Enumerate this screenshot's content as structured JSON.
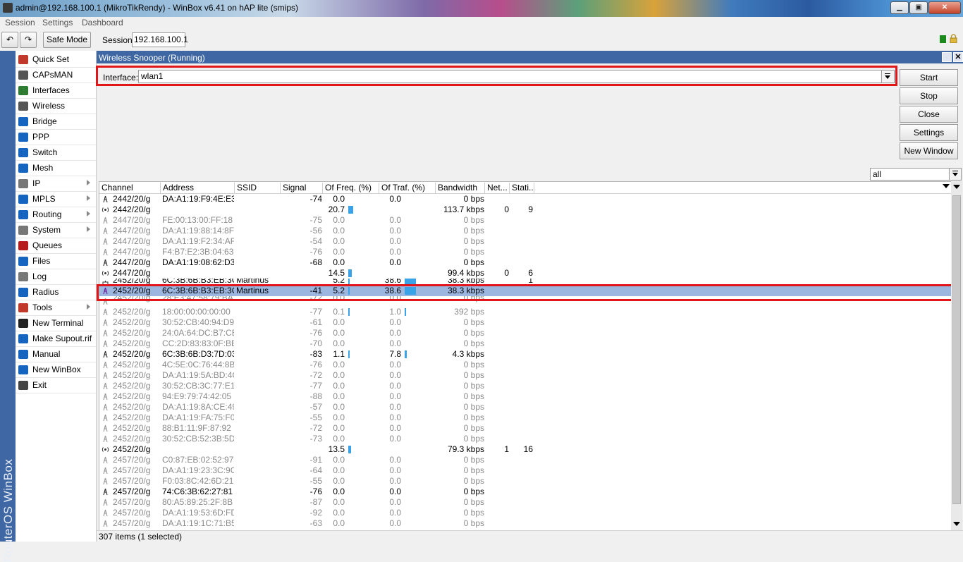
{
  "window": {
    "title": "admin@192.168.100.1 (MikroTikRendy) - WinBox v6.41 on hAP lite (smips)",
    "min_glyph": "▁",
    "max_glyph": "▣",
    "close_glyph": "✕"
  },
  "menubar": [
    "Session",
    "Settings",
    "Dashboard"
  ],
  "toolbar": {
    "undo_glyph": "↶",
    "redo_glyph": "↷",
    "safe_mode_label": "Safe Mode",
    "session_label": "Session:",
    "session_value": "192.168.100.1"
  },
  "side_strip_text": "RouterOS WinBox",
  "left_menu": [
    {
      "label": "Quick Set",
      "icon": "wand-icon",
      "color": "#c0392b",
      "submenu": false
    },
    {
      "label": "CAPsMAN",
      "icon": "antenna-icon",
      "color": "#555555",
      "submenu": false
    },
    {
      "label": "Interfaces",
      "icon": "interfaces-icon",
      "color": "#2e7d32",
      "submenu": false
    },
    {
      "label": "Wireless",
      "icon": "wireless-icon",
      "color": "#555555",
      "submenu": false
    },
    {
      "label": "Bridge",
      "icon": "bridge-icon",
      "color": "#1565c0",
      "submenu": false
    },
    {
      "label": "PPP",
      "icon": "ppp-icon",
      "color": "#1565c0",
      "submenu": false
    },
    {
      "label": "Switch",
      "icon": "switch-icon",
      "color": "#1565c0",
      "submenu": false
    },
    {
      "label": "Mesh",
      "icon": "mesh-icon",
      "color": "#1565c0",
      "submenu": false
    },
    {
      "label": "IP",
      "icon": "ip-icon",
      "color": "#777777",
      "submenu": true
    },
    {
      "label": "MPLS",
      "icon": "mpls-icon",
      "color": "#1565c0",
      "submenu": true
    },
    {
      "label": "Routing",
      "icon": "routing-icon",
      "color": "#1565c0",
      "submenu": true
    },
    {
      "label": "System",
      "icon": "system-icon",
      "color": "#777777",
      "submenu": true
    },
    {
      "label": "Queues",
      "icon": "queues-icon",
      "color": "#b71c1c",
      "submenu": false
    },
    {
      "label": "Files",
      "icon": "files-icon",
      "color": "#1565c0",
      "submenu": false
    },
    {
      "label": "Log",
      "icon": "log-icon",
      "color": "#777777",
      "submenu": false
    },
    {
      "label": "Radius",
      "icon": "radius-icon",
      "color": "#1565c0",
      "submenu": false
    },
    {
      "label": "Tools",
      "icon": "tools-icon",
      "color": "#c0392b",
      "submenu": true
    },
    {
      "label": "New Terminal",
      "icon": "terminal-icon",
      "color": "#222222",
      "submenu": false
    },
    {
      "label": "Make Supout.rif",
      "icon": "supout-icon",
      "color": "#1565c0",
      "submenu": false
    },
    {
      "label": "Manual",
      "icon": "manual-icon",
      "color": "#1565c0",
      "submenu": false
    },
    {
      "label": "New WinBox",
      "icon": "winbox-icon",
      "color": "#1565c0",
      "submenu": false
    },
    {
      "label": "Exit",
      "icon": "exit-icon",
      "color": "#444444",
      "submenu": false
    }
  ],
  "snooper": {
    "title": "Wireless Snooper (Running)",
    "close_glyph": "✕",
    "interface_label": "Interface:",
    "interface_value": "wlan1",
    "buttons": [
      "Start",
      "Stop",
      "Close",
      "Settings",
      "New Window"
    ],
    "filter_value": "all",
    "columns": [
      "Channel",
      "Address",
      "SSID",
      "Signal",
      "Of Freq. (%)",
      "Of Traf. (%)",
      "Bandwidth",
      "Net...",
      "Stati..."
    ],
    "status_text": "307 items (1 selected)",
    "bar_color": "#3aa3e8",
    "selected_color": "#9bb7e0",
    "highlight_color": "#e0161b"
  },
  "rows": [
    {
      "kind": "station",
      "dim": false,
      "channel": "2442/20/g",
      "address": "DA:A1:19:F9:4E:E3",
      "ssid": "",
      "signal": "-74",
      "freq": "0.0",
      "freq_bar": 0,
      "traf": "0.0",
      "traf_bar": 0,
      "bw": "0 bps",
      "net": "",
      "stations": ""
    },
    {
      "kind": "channel",
      "dim": false,
      "channel": "2442/20/g",
      "address": "",
      "ssid": "",
      "signal": "",
      "freq": "20.7",
      "freq_bar": 20.7,
      "traf": "",
      "traf_bar": 0,
      "bw": "113.7 kbps",
      "net": "0",
      "stations": "9"
    },
    {
      "kind": "station",
      "dim": true,
      "channel": "2447/20/g",
      "address": "FE:00:13:00:FF:18",
      "ssid": "",
      "signal": "-75",
      "freq": "0.0",
      "freq_bar": 0,
      "traf": "0.0",
      "traf_bar": 0,
      "bw": "0 bps",
      "net": "",
      "stations": ""
    },
    {
      "kind": "station",
      "dim": true,
      "channel": "2447/20/g",
      "address": "DA:A1:19:88:14:8F",
      "ssid": "",
      "signal": "-56",
      "freq": "0.0",
      "freq_bar": 0,
      "traf": "0.0",
      "traf_bar": 0,
      "bw": "0 bps",
      "net": "",
      "stations": ""
    },
    {
      "kind": "station",
      "dim": true,
      "channel": "2447/20/g",
      "address": "DA:A1:19:F2:34:AF",
      "ssid": "",
      "signal": "-54",
      "freq": "0.0",
      "freq_bar": 0,
      "traf": "0.0",
      "traf_bar": 0,
      "bw": "0 bps",
      "net": "",
      "stations": ""
    },
    {
      "kind": "station",
      "dim": true,
      "channel": "2447/20/g",
      "address": "F4:B7:E2:3B:04:63",
      "ssid": "",
      "signal": "-76",
      "freq": "0.0",
      "freq_bar": 0,
      "traf": "0.0",
      "traf_bar": 0,
      "bw": "0 bps",
      "net": "",
      "stations": ""
    },
    {
      "kind": "station",
      "dim": false,
      "channel": "2447/20/g",
      "address": "DA:A1:19:08:62:D3",
      "ssid": "",
      "signal": "-68",
      "freq": "0.0",
      "freq_bar": 0,
      "traf": "0.0",
      "traf_bar": 0,
      "bw": "0 bps",
      "net": "",
      "stations": ""
    },
    {
      "kind": "channel",
      "dim": false,
      "channel": "2447/20/g",
      "address": "",
      "ssid": "",
      "signal": "",
      "freq": "14.5",
      "freq_bar": 14.5,
      "traf": "",
      "traf_bar": 0,
      "bw": "99.4 kbps",
      "net": "0",
      "stations": "6"
    },
    {
      "kind": "network",
      "dim": false,
      "partial": true,
      "channel": "2452/20/g",
      "address": "6C:3B:6B:B3:EB:3C",
      "ssid": "Martinus",
      "signal": "",
      "freq": "5.2",
      "freq_bar": 5.2,
      "traf": "38.6",
      "traf_bar": 38.6,
      "bw": "38.3 kbps",
      "net": "",
      "stations": "1"
    },
    {
      "kind": "station",
      "dim": false,
      "selected": true,
      "channel": "2452/20/g",
      "address": "6C:3B:6B:B3:EB:3C",
      "ssid": "Martinus",
      "signal": "-41",
      "freq": "5.2",
      "freq_bar": 5.2,
      "traf": "38.6",
      "traf_bar": 38.6,
      "bw": "38.3 kbps",
      "net": "",
      "stations": ""
    },
    {
      "kind": "station",
      "dim": true,
      "partial": true,
      "channel": "2452/20/g",
      "address": "28:E3:47:58:79:BA",
      "ssid": "",
      "signal": "-72",
      "freq": "0.0",
      "freq_bar": 0,
      "traf": "0.0",
      "traf_bar": 0,
      "bw": "0 bps",
      "net": "",
      "stations": ""
    },
    {
      "kind": "station",
      "dim": true,
      "channel": "2452/20/g",
      "address": "18:00:00:00:00:00",
      "ssid": "",
      "signal": "-77",
      "freq": "0.1",
      "freq_bar": 0.1,
      "traf": "1.0",
      "traf_bar": 1.0,
      "bw": "392 bps",
      "net": "",
      "stations": ""
    },
    {
      "kind": "station",
      "dim": true,
      "channel": "2452/20/g",
      "address": "30:52:CB:40:94:D9",
      "ssid": "",
      "signal": "-61",
      "freq": "0.0",
      "freq_bar": 0,
      "traf": "0.0",
      "traf_bar": 0,
      "bw": "0 bps",
      "net": "",
      "stations": ""
    },
    {
      "kind": "station",
      "dim": true,
      "channel": "2452/20/g",
      "address": "24:0A:64:DC:B7:CB",
      "ssid": "",
      "signal": "-76",
      "freq": "0.0",
      "freq_bar": 0,
      "traf": "0.0",
      "traf_bar": 0,
      "bw": "0 bps",
      "net": "",
      "stations": ""
    },
    {
      "kind": "station",
      "dim": true,
      "channel": "2452/20/g",
      "address": "CC:2D:83:83:0F:BB",
      "ssid": "",
      "signal": "-70",
      "freq": "0.0",
      "freq_bar": 0,
      "traf": "0.0",
      "traf_bar": 0,
      "bw": "0 bps",
      "net": "",
      "stations": ""
    },
    {
      "kind": "station",
      "dim": false,
      "channel": "2452/20/g",
      "address": "6C:3B:6B:D3:7D:03",
      "ssid": "",
      "signal": "-83",
      "freq": "1.1",
      "freq_bar": 1.1,
      "traf": "7.8",
      "traf_bar": 7.8,
      "bw": "4.3 kbps",
      "net": "",
      "stations": ""
    },
    {
      "kind": "station",
      "dim": true,
      "channel": "2452/20/g",
      "address": "4C:5E:0C:76:44:8B",
      "ssid": "",
      "signal": "-76",
      "freq": "0.0",
      "freq_bar": 0,
      "traf": "0.0",
      "traf_bar": 0,
      "bw": "0 bps",
      "net": "",
      "stations": ""
    },
    {
      "kind": "station",
      "dim": true,
      "channel": "2452/20/g",
      "address": "DA:A1:19:5A:BD:4C",
      "ssid": "",
      "signal": "-72",
      "freq": "0.0",
      "freq_bar": 0,
      "traf": "0.0",
      "traf_bar": 0,
      "bw": "0 bps",
      "net": "",
      "stations": ""
    },
    {
      "kind": "station",
      "dim": true,
      "channel": "2452/20/g",
      "address": "30:52:CB:3C:77:E1",
      "ssid": "",
      "signal": "-77",
      "freq": "0.0",
      "freq_bar": 0,
      "traf": "0.0",
      "traf_bar": 0,
      "bw": "0 bps",
      "net": "",
      "stations": ""
    },
    {
      "kind": "station",
      "dim": true,
      "channel": "2452/20/g",
      "address": "94:E9:79:74:42:05",
      "ssid": "",
      "signal": "-88",
      "freq": "0.0",
      "freq_bar": 0,
      "traf": "0.0",
      "traf_bar": 0,
      "bw": "0 bps",
      "net": "",
      "stations": ""
    },
    {
      "kind": "station",
      "dim": true,
      "channel": "2452/20/g",
      "address": "DA:A1:19:8A:CE:49",
      "ssid": "",
      "signal": "-57",
      "freq": "0.0",
      "freq_bar": 0,
      "traf": "0.0",
      "traf_bar": 0,
      "bw": "0 bps",
      "net": "",
      "stations": ""
    },
    {
      "kind": "station",
      "dim": true,
      "channel": "2452/20/g",
      "address": "DA:A1:19:FA:75:F0",
      "ssid": "",
      "signal": "-55",
      "freq": "0.0",
      "freq_bar": 0,
      "traf": "0.0",
      "traf_bar": 0,
      "bw": "0 bps",
      "net": "",
      "stations": ""
    },
    {
      "kind": "station",
      "dim": true,
      "channel": "2452/20/g",
      "address": "88:B1:11:9F:87:92",
      "ssid": "",
      "signal": "-72",
      "freq": "0.0",
      "freq_bar": 0,
      "traf": "0.0",
      "traf_bar": 0,
      "bw": "0 bps",
      "net": "",
      "stations": ""
    },
    {
      "kind": "station",
      "dim": true,
      "channel": "2452/20/g",
      "address": "30:52:CB:52:3B:5D",
      "ssid": "",
      "signal": "-73",
      "freq": "0.0",
      "freq_bar": 0,
      "traf": "0.0",
      "traf_bar": 0,
      "bw": "0 bps",
      "net": "",
      "stations": ""
    },
    {
      "kind": "channel",
      "dim": false,
      "channel": "2452/20/g",
      "address": "",
      "ssid": "",
      "signal": "",
      "freq": "13.5",
      "freq_bar": 13.5,
      "traf": "",
      "traf_bar": 0,
      "bw": "79.3 kbps",
      "net": "1",
      "stations": "16"
    },
    {
      "kind": "station",
      "dim": true,
      "channel": "2457/20/g",
      "address": "C0:87:EB:02:52:97",
      "ssid": "",
      "signal": "-91",
      "freq": "0.0",
      "freq_bar": 0,
      "traf": "0.0",
      "traf_bar": 0,
      "bw": "0 bps",
      "net": "",
      "stations": ""
    },
    {
      "kind": "station",
      "dim": true,
      "channel": "2457/20/g",
      "address": "DA:A1:19:23:3C:9C",
      "ssid": "",
      "signal": "-64",
      "freq": "0.0",
      "freq_bar": 0,
      "traf": "0.0",
      "traf_bar": 0,
      "bw": "0 bps",
      "net": "",
      "stations": ""
    },
    {
      "kind": "station",
      "dim": true,
      "channel": "2457/20/g",
      "address": "F0:03:8C:42:6D:21",
      "ssid": "",
      "signal": "-55",
      "freq": "0.0",
      "freq_bar": 0,
      "traf": "0.0",
      "traf_bar": 0,
      "bw": "0 bps",
      "net": "",
      "stations": ""
    },
    {
      "kind": "station",
      "dim": false,
      "channel": "2457/20/g",
      "address": "74:C6:3B:62:27:81",
      "ssid": "",
      "signal": "-76",
      "freq": "0.0",
      "freq_bar": 0,
      "traf": "0.0",
      "traf_bar": 0,
      "bw": "0 bps",
      "net": "",
      "stations": ""
    },
    {
      "kind": "station",
      "dim": true,
      "channel": "2457/20/g",
      "address": "80:A5:89:25:2F:8B",
      "ssid": "",
      "signal": "-87",
      "freq": "0.0",
      "freq_bar": 0,
      "traf": "0.0",
      "traf_bar": 0,
      "bw": "0 bps",
      "net": "",
      "stations": ""
    },
    {
      "kind": "station",
      "dim": true,
      "channel": "2457/20/g",
      "address": "DA:A1:19:53:6D:FD",
      "ssid": "",
      "signal": "-92",
      "freq": "0.0",
      "freq_bar": 0,
      "traf": "0.0",
      "traf_bar": 0,
      "bw": "0 bps",
      "net": "",
      "stations": ""
    },
    {
      "kind": "station",
      "dim": true,
      "channel": "2457/20/g",
      "address": "DA:A1:19:1C:71:B5",
      "ssid": "",
      "signal": "-63",
      "freq": "0.0",
      "freq_bar": 0,
      "traf": "0.0",
      "traf_bar": 0,
      "bw": "0 bps",
      "net": "",
      "stations": ""
    }
  ]
}
